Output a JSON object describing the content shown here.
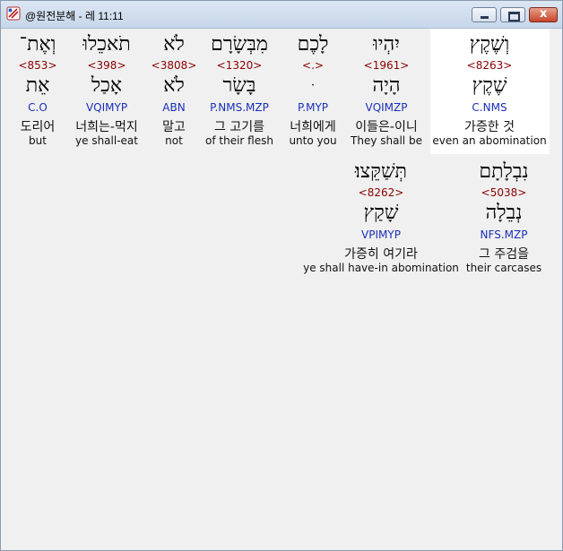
{
  "window": {
    "title": "@원전분해 - 레 11:11"
  },
  "words": [
    {
      "surface": "וְשֶׁקֶץ",
      "strong": "<8263>",
      "lemma": "שֶׁקֶץ",
      "morph": "C.NMS",
      "korean": "가증한 것",
      "english": "even an abomination"
    },
    {
      "surface": "יִהְיוּ",
      "strong": "<1961>",
      "lemma": "הָיָה",
      "morph": "VQIMZP",
      "korean": "이들은-이니",
      "english": "They shall be"
    },
    {
      "surface": "לָכֶם",
      "strong": "<.>",
      "lemma": "ּ",
      "morph": "P.MYP",
      "korean": "너희에게",
      "english": "unto you"
    },
    {
      "surface": "מִבְּשָׂרָם",
      "strong": "<1320>",
      "lemma": "בָּשָׂר",
      "morph": "P.NMS.MZP",
      "korean": "그 고기를",
      "english": "of their flesh"
    },
    {
      "surface": "לֹא",
      "strong": "<3808>",
      "lemma": "לֹא",
      "morph": "ABN",
      "korean": "말고",
      "english": "not"
    },
    {
      "surface": "תֹאכֵלוּ",
      "strong": "<398>",
      "lemma": "אָכַל",
      "morph": "VQIMYP",
      "korean": "너희는-먹지",
      "english": "ye shall-eat"
    },
    {
      "surface": "וְאֶת־",
      "strong": "<853>",
      "lemma": "אֵת",
      "morph": "C.O",
      "korean": "도리어",
      "english": "but"
    },
    {
      "surface": "נִבְלָתָם",
      "strong": "<5038>",
      "lemma": "נְבֵלָה",
      "morph": "NFS.MZP",
      "korean": "그 주검을",
      "english": "their carcases"
    },
    {
      "surface": "תְּשַׁקֵּצוּ׃",
      "strong": "<8262>",
      "lemma": "שָׁקַץ",
      "morph": "VPIMYP",
      "korean": "가증히 여기라",
      "english": "ye shall have-in abomination"
    }
  ]
}
